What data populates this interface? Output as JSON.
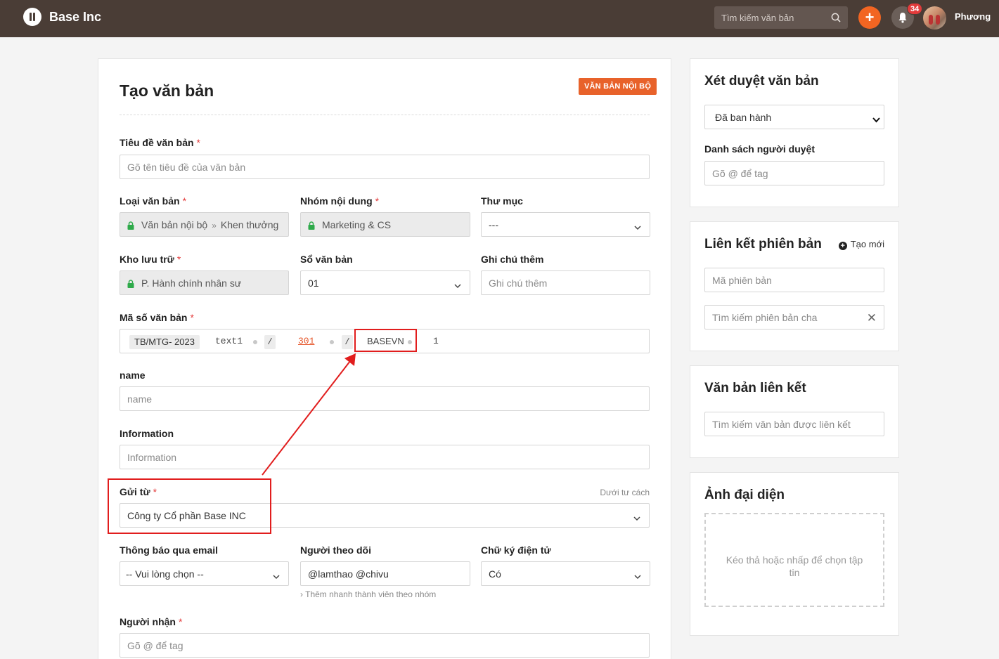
{
  "topbar": {
    "brand": "Base Inc",
    "search_placeholder": "Tìm kiếm văn bản",
    "add_label": "+",
    "notification_count": "34",
    "user_name": "Phương"
  },
  "main": {
    "title": "Tạo văn bản",
    "internal_tag": "VĂN BẢN NỘI BỘ",
    "required_mark": "*",
    "doc_title": {
      "label": "Tiêu đề văn bản",
      "placeholder": "Gõ tên tiêu đề của văn bản"
    },
    "doc_type": {
      "label": "Loại văn bản",
      "value_parent": "Văn bản nội bộ",
      "sep": "»",
      "value_child": "Khen thưởng"
    },
    "content_group": {
      "label": "Nhóm nội dung",
      "value": "Marketing & CS"
    },
    "folder": {
      "label": "Thư mục",
      "value": "---"
    },
    "storage": {
      "label": "Kho lưu trữ",
      "value": "P. Hành chính nhân sư"
    },
    "doc_book": {
      "label": "Sổ văn bản",
      "value": "01"
    },
    "extra_note": {
      "label": "Ghi chú thêm",
      "placeholder": "Ghi chú thêm"
    },
    "doc_code": {
      "label": "Mã số văn bản",
      "prefix": "TB/MTG- 2023",
      "text1": "text1",
      "slash": "/",
      "number": "301",
      "suffix": "BASEVN",
      "seq": "1"
    },
    "name_field": {
      "label": "name",
      "placeholder": "name"
    },
    "information": {
      "label": "Information",
      "placeholder": "Information"
    },
    "sent_from": {
      "label": "Gửi từ",
      "value": "Công ty Cổ phần Base INC",
      "hint": "Dưới tư cách"
    },
    "email_notify": {
      "label": "Thông báo qua email",
      "value": "-- Vui lòng chọn --"
    },
    "followers": {
      "label": "Người theo dõi",
      "value": "@lamthao @chivu",
      "hint": "› Thêm nhanh thành viên theo nhóm"
    },
    "e_signature": {
      "label": "Chữ ký điện tử",
      "value": "Có"
    },
    "recipients": {
      "label": "Người nhận",
      "placeholder": "Gõ @ để tag"
    }
  },
  "approval": {
    "title": "Xét duyệt văn bản",
    "status_value": "Đã ban hành",
    "approvers_label": "Danh sách người duyệt",
    "approvers_placeholder": "Gõ @ để tag"
  },
  "version_link": {
    "title": "Liên kết phiên bản",
    "create_label": "Tạo mới",
    "code_placeholder": "Mã phiên bản",
    "parent_placeholder": "Tìm kiếm phiên bản cha"
  },
  "linked_docs": {
    "title": "Văn bản liên kết",
    "search_placeholder": "Tìm kiếm văn bản được liên kết"
  },
  "avatar_card": {
    "title": "Ảnh đại diện",
    "dropzone_text": "Kéo thả hoặc nhấp để chọn tập tin"
  },
  "colors": {
    "topbar": "#4a3d36",
    "accent": "#f26522",
    "annotation": "#e11d1d"
  }
}
